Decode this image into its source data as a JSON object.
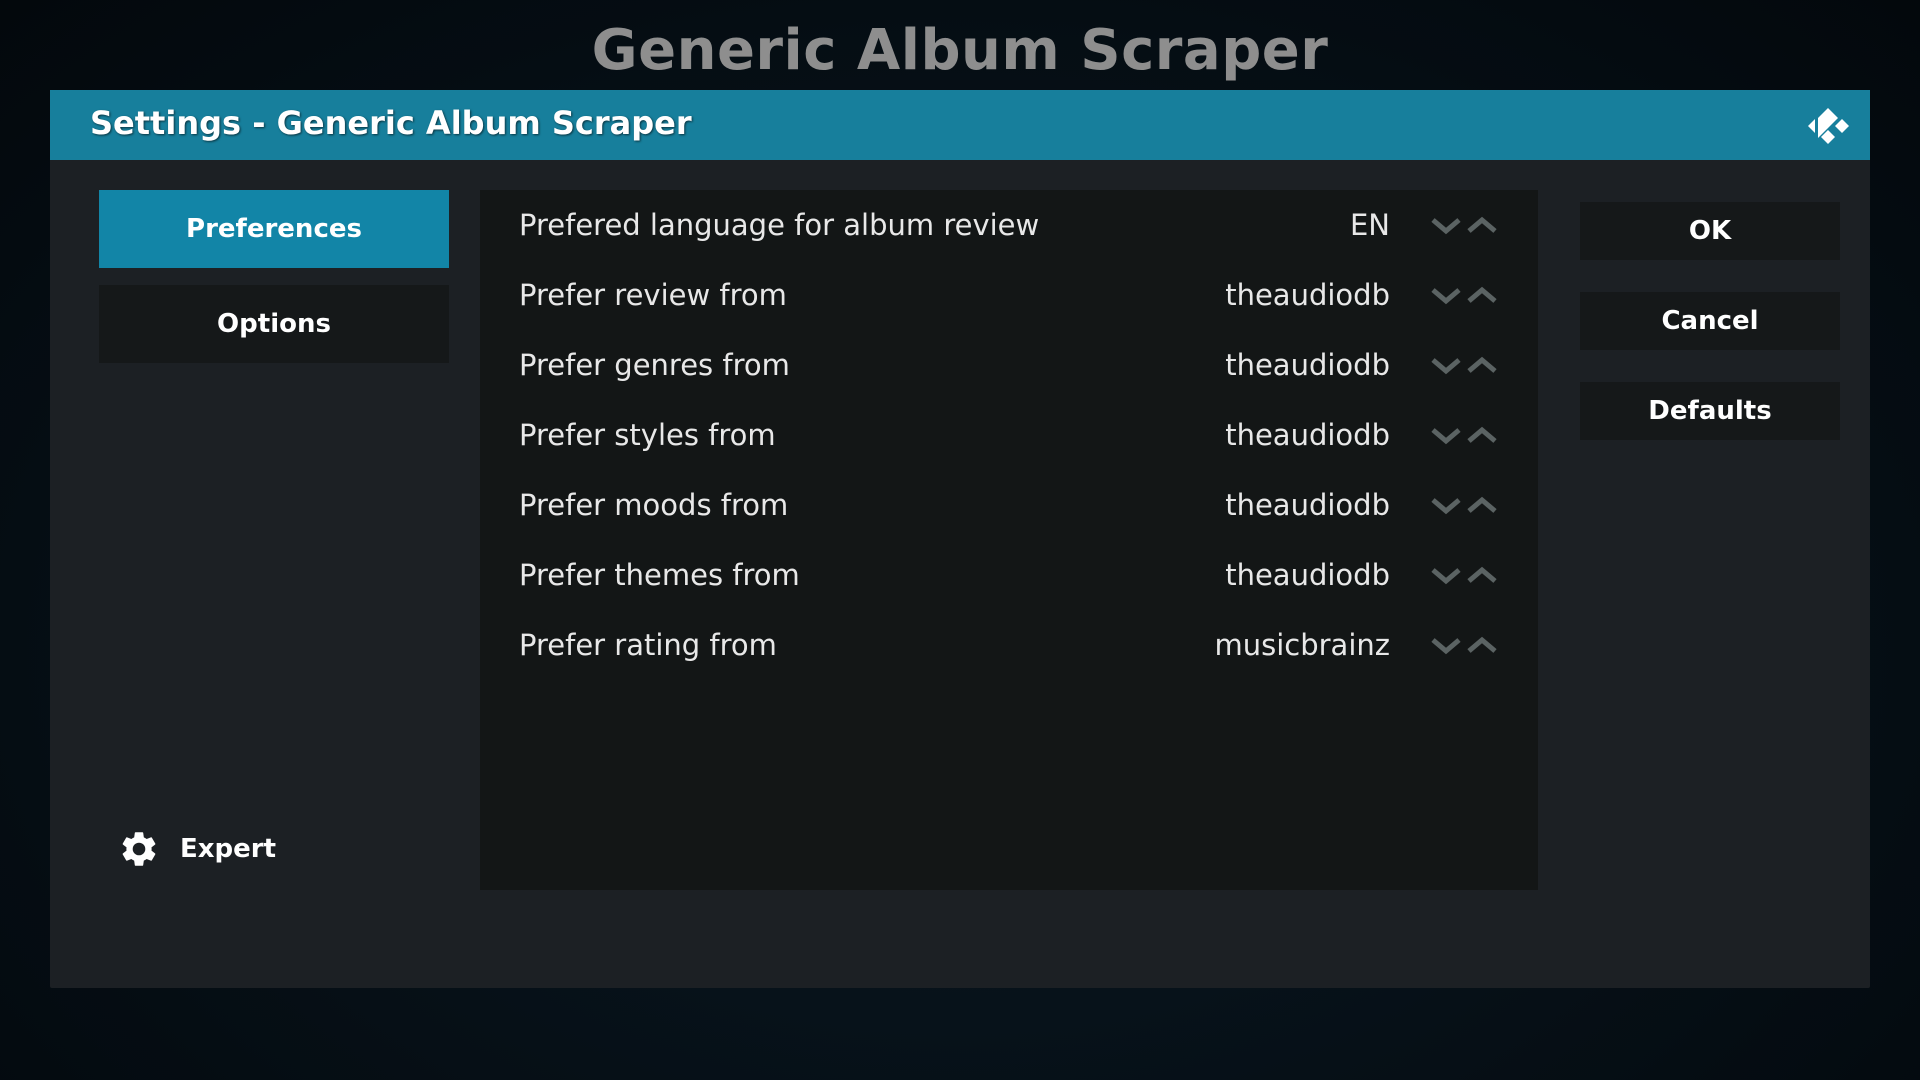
{
  "page_title": "Generic Album Scraper",
  "dialog": {
    "title": "Settings - Generic Album Scraper",
    "logo_icon": "kodi-logo-icon"
  },
  "categories": [
    {
      "label": "Preferences",
      "active": true
    },
    {
      "label": "Options",
      "active": false
    }
  ],
  "settings_level": {
    "label": "Expert",
    "icon": "gear-icon"
  },
  "settings": [
    {
      "label": "Prefered language for album review",
      "value": "EN"
    },
    {
      "label": "Prefer review from",
      "value": "theaudiodb"
    },
    {
      "label": "Prefer genres from",
      "value": "theaudiodb"
    },
    {
      "label": "Prefer styles from",
      "value": "theaudiodb"
    },
    {
      "label": "Prefer moods from",
      "value": "theaudiodb"
    },
    {
      "label": "Prefer themes from",
      "value": "theaudiodb"
    },
    {
      "label": "Prefer rating from",
      "value": "musicbrainz"
    }
  ],
  "actions": {
    "ok": "OK",
    "cancel": "Cancel",
    "defaults": "Defaults"
  },
  "colors": {
    "accent": "#177f9c",
    "active_button": "#1285a7"
  }
}
